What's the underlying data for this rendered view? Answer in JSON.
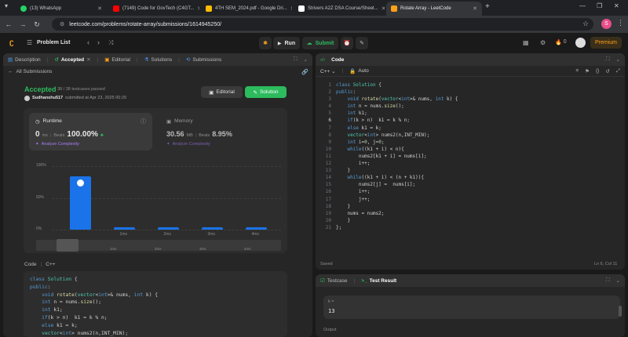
{
  "browser": {
    "tabs": [
      {
        "title": "(13) WhatsApp",
        "color": "#25d366"
      },
      {
        "title": "(7149) Code for GovTech (C4GT...",
        "color": "#ff0000"
      },
      {
        "title": "4TH SEM_2024.pdf - Google Dri...",
        "color": "#fbbc04"
      },
      {
        "title": "Strivers A2Z DSA Course/Sheet...",
        "color": "#ffffff"
      },
      {
        "title": "Rotate Array - LeetCode",
        "color": "#ffa116"
      }
    ],
    "url": "leetcode.com/problems/rotate-array/submissions/1614945250/",
    "profile_letter": "S"
  },
  "nav": {
    "problem_list": "Problem List",
    "run": "Run",
    "submit": "Submit",
    "streak": "0",
    "premium": "Premium"
  },
  "left": {
    "tabs": [
      {
        "label": "Description",
        "active": false
      },
      {
        "label": "Accepted",
        "active": true
      },
      {
        "label": "Editorial",
        "active": false
      },
      {
        "label": "Solutions",
        "active": false
      },
      {
        "label": "Submissions",
        "active": false
      }
    ],
    "all_submissions": "All Submissions",
    "status": "Accepted",
    "testcases": "38 / 38 testcases passed",
    "user": "Sudhanshu517",
    "submitted": "submitted at Apr 23, 2025 00:29",
    "editorial_btn": "Editorial",
    "solution_btn": "Solution",
    "runtime": {
      "label": "Runtime",
      "value": "0",
      "unit": "ms",
      "beats_label": "Beats",
      "beats": "100.00%",
      "analyze": "Analyze Complexity"
    },
    "memory": {
      "label": "Memory",
      "value": "30.56",
      "unit": "MB",
      "beats_label": "Beats",
      "beats": "8.95%",
      "analyze": "Analyze Complexity"
    },
    "code_label": "Code",
    "lang_label": "C++"
  },
  "chart_data": {
    "type": "bar",
    "categories": [
      "0ms",
      "1ms",
      "2ms",
      "3ms",
      "4ms"
    ],
    "values": [
      84,
      2,
      2,
      3,
      2
    ],
    "y_ticks": [
      "100%",
      "50%",
      "0%"
    ],
    "ylim": [
      0,
      100
    ],
    "navigator_labels": [
      "1ms",
      "2ms",
      "3ms",
      "4ms"
    ]
  },
  "editor": {
    "title": "Code",
    "lang": "C++",
    "mode": "Auto",
    "saved": "Saved",
    "cursor": "Ln 6, Col 11",
    "lines": [
      "class Solution {",
      "public:",
      "    void rotate(vector<int>& nums, int k) {",
      "    int n = nums.size();",
      "    int k1;",
      "    if(k > n)  k1 = k % n;",
      "    else k1 = k;",
      "    vector<int> nums2(n,INT_MIN);",
      "    int i=0, j=0;",
      "    while((k1 + i) < n){",
      "        nums2[k1 + i] = nums[i];",
      "        i++;",
      "    }",
      "    while((k1 + i) < (n + k1)){",
      "        nums2[j] =  nums[i];",
      "        i++;",
      "        j++;",
      "    }",
      "    nums = nums2;",
      "    }",
      "};"
    ]
  },
  "testpanel": {
    "tab1": "Testcase",
    "tab2": "Test Result",
    "k_label": "k =",
    "k_value": "13",
    "output_label": "Output"
  }
}
